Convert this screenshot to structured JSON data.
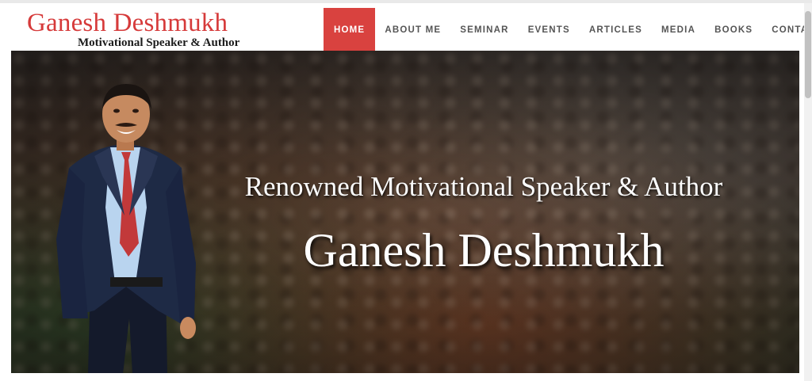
{
  "brand": {
    "name": "Ganesh Deshmukh",
    "tagline": "Motivational Speaker & Author"
  },
  "nav": {
    "items": [
      {
        "label": "HOME"
      },
      {
        "label": "ABOUT ME"
      },
      {
        "label": "SEMINAR"
      },
      {
        "label": "EVENTS"
      },
      {
        "label": "ARTICLES"
      },
      {
        "label": "MEDIA"
      },
      {
        "label": "BOOKS"
      },
      {
        "label": "CONTACT"
      }
    ],
    "active": "HOME"
  },
  "hero": {
    "subtitle": "Renowned Motivational Speaker & Author",
    "title": "Ganesh Deshmukh"
  },
  "colors": {
    "accent": "#d9423f",
    "brand_red": "#d63a3a",
    "nav_text": "#555555"
  }
}
